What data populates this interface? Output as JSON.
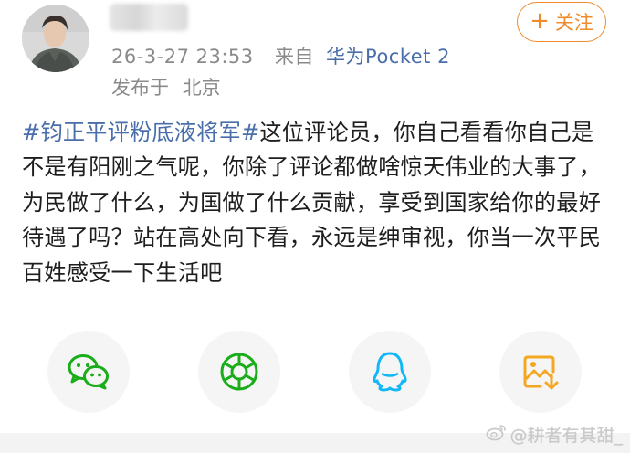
{
  "header": {
    "time": "26-3-27 23:53",
    "source_prefix": "来自",
    "device": "华为Pocket 2",
    "location_prefix": "发布于",
    "location": "北京",
    "follow": {
      "plus": "+",
      "label": "关注"
    }
  },
  "post": {
    "hashtag": "#钧正平评粉底液将军#",
    "text": "这位评论员，你自己看看你自己是不是有阳刚之气呢，你除了评论都做啥惊天伟业的大事了，为民做了什么，为国做了什么贡献，享受到国家给你的最好待遇了吗？站在高处向下看，永远是绅审视，你当一次平民百姓感受一下生活吧"
  },
  "share": {
    "icons": [
      "wechat-icon",
      "moments-icon",
      "qq-icon",
      "save-image-icon"
    ]
  },
  "watermark": {
    "text": "@耕者有其甜_"
  },
  "colors": {
    "accent": "#f08b2c",
    "link": "#4a6ea9",
    "meta": "#8a8a8a",
    "wechat": "#1aad19",
    "qq": "#12b7f5",
    "save": "#f5a623"
  }
}
